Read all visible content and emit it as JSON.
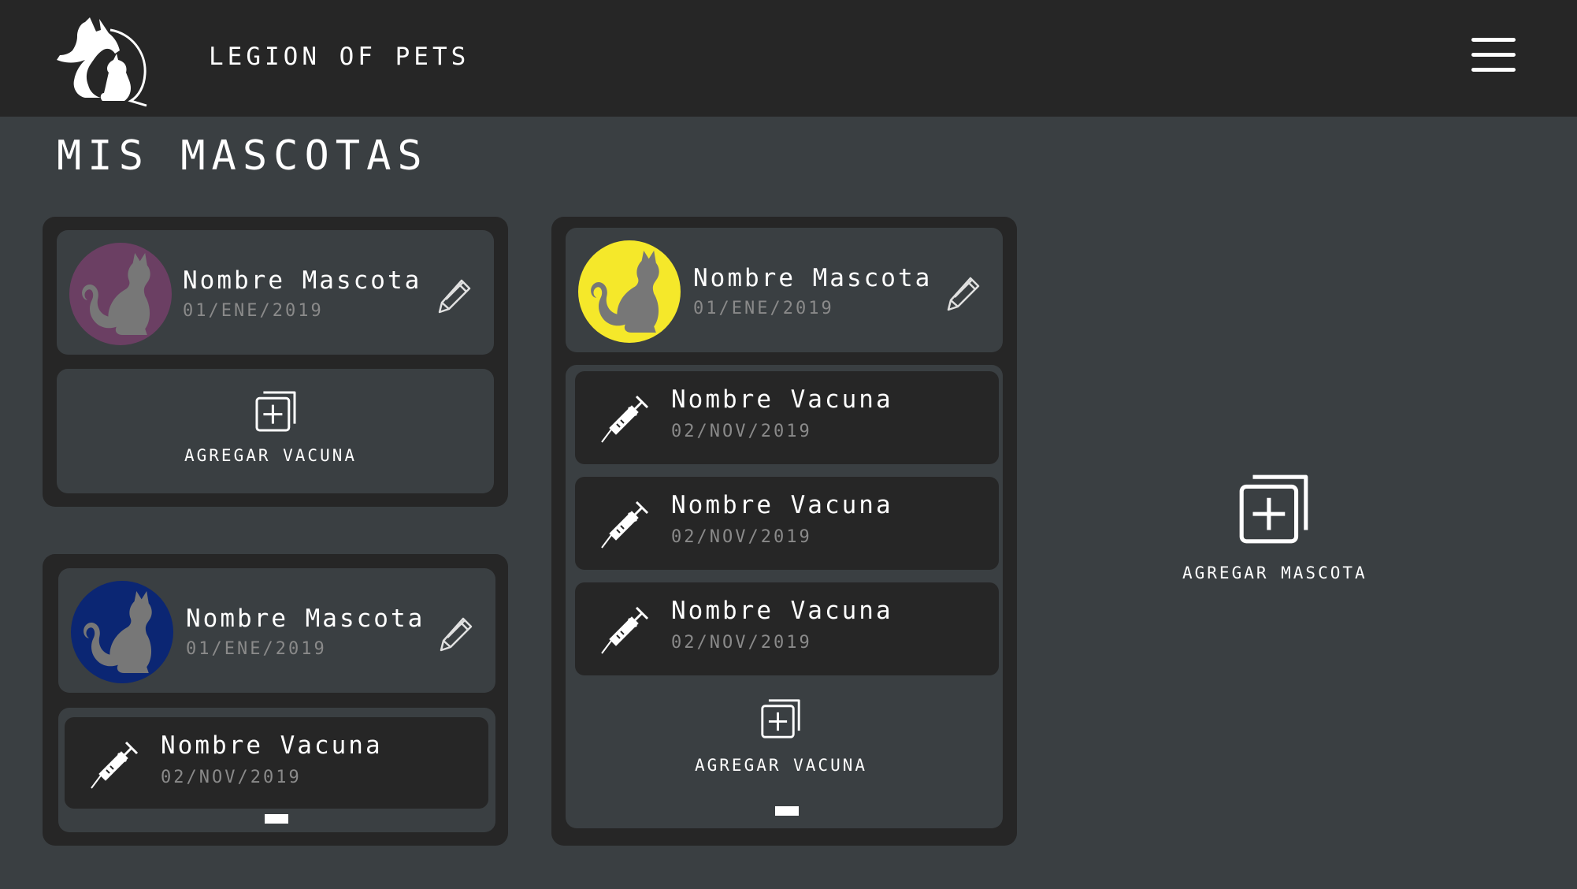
{
  "header": {
    "brand": "LEGION OF PETS",
    "logo_icon": "dog-cat-logo-icon",
    "menu_icon": "hamburger-menu-icon"
  },
  "page": {
    "title": "MIS MASCOTAS"
  },
  "colors": {
    "background": "#3a3f42",
    "panel": "#262626",
    "avatar_purple": "#6b3f63",
    "avatar_navy": "#0b2673",
    "avatar_yellow": "#f5e82a",
    "silhouette": "#777777"
  },
  "pets": [
    {
      "name": "Nombre Mascota",
      "date": "01/ENE/2019",
      "avatar_color": "#6b3f63",
      "add_vaccine_label": "AGREGAR VACUNA",
      "vaccines": []
    },
    {
      "name": "Nombre Mascota",
      "date": "01/ENE/2019",
      "avatar_color": "#0b2673",
      "vaccines": [
        {
          "name": "Nombre Vacuna",
          "date": "02/NOV/2019"
        }
      ]
    },
    {
      "name": "Nombre Mascota",
      "date": "01/ENE/2019",
      "avatar_color": "#f5e82a",
      "add_vaccine_label": "AGREGAR VACUNA",
      "vaccines": [
        {
          "name": "Nombre Vacuna",
          "date": "02/NOV/2019"
        },
        {
          "name": "Nombre Vacuna",
          "date": "02/NOV/2019"
        },
        {
          "name": "Nombre Vacuna",
          "date": "02/NOV/2019"
        }
      ]
    }
  ],
  "add_pet": {
    "label": "AGREGAR MASCOTA",
    "icon": "add-copy-icon"
  }
}
